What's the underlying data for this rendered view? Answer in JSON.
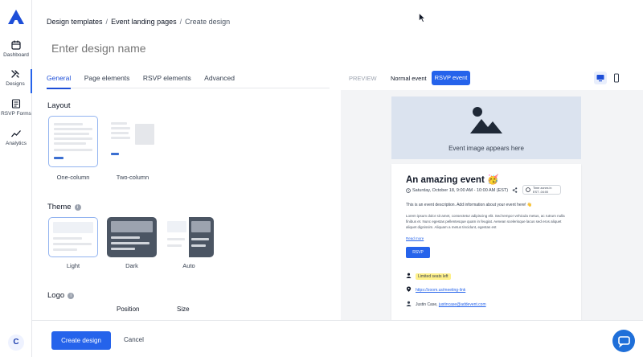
{
  "sidebar": {
    "items": [
      {
        "label": "Dashboard",
        "icon": "calendar-icon"
      },
      {
        "label": "Designs",
        "icon": "brush-icon",
        "active": true
      },
      {
        "label": "RSVP Forms",
        "icon": "form-icon"
      },
      {
        "label": "Analytics",
        "icon": "chart-line-icon"
      }
    ],
    "avatar": "C"
  },
  "breadcrumb": {
    "items": [
      "Design templates",
      "Event landing pages"
    ],
    "separator": "/",
    "current": "Create design"
  },
  "design_name": {
    "placeholder": "Enter design name",
    "value": ""
  },
  "tabs": [
    "General",
    "Page elements",
    "RSVP elements",
    "Advanced"
  ],
  "layout": {
    "title": "Layout",
    "options": [
      {
        "label": "One-column",
        "selected": true
      },
      {
        "label": "Two-column",
        "selected": false
      }
    ]
  },
  "theme": {
    "title": "Theme",
    "options": [
      {
        "label": "Light",
        "selected": true
      },
      {
        "label": "Dark",
        "selected": false
      },
      {
        "label": "Auto",
        "selected": false
      }
    ]
  },
  "logo": {
    "title": "Logo",
    "columns": [
      "Position",
      "Size"
    ]
  },
  "preview": {
    "label": "PREVIEW",
    "modes": [
      "Normal event",
      "RSVP event"
    ],
    "active_mode": "RSVP event",
    "device_icons": [
      "desktop-icon",
      "mobile-icon"
    ],
    "hero_text": "Event image appears here",
    "event": {
      "title": "An amazing event 🥳",
      "date": "Saturday, October 18, 9:00 AM - 10:00 AM (EST)",
      "timezone_chip": [
        "Time zones in",
        "EST -04:00"
      ],
      "description": "This is an event description. Add information about your event here! 👋",
      "lorem": "Lorem ipsum dolor sit amet, consectetur adipiscing elit. Sed tempor vehicula metus, ac rutrum nulla finibus et. Nunc egestas pellentesque quam in feugiat. Aenean scelerisque lacus sed eros aliquet aliquet dignissim. Aliquam a metus tincidunt, egestas est",
      "read_more": "Read more",
      "rsvp_label": "RSVP",
      "seats_badge": "Limited seats left",
      "link": "https://zoom.us/meeting-link",
      "organizer_name": "Justin Case,",
      "organizer_email": "justincase@addevent.com"
    }
  },
  "footer": {
    "create_label": "Create design",
    "cancel_label": "Cancel"
  },
  "colors": {
    "accent": "#2563eb",
    "hero": "#dbe3ef",
    "badge": "#fef08a"
  }
}
